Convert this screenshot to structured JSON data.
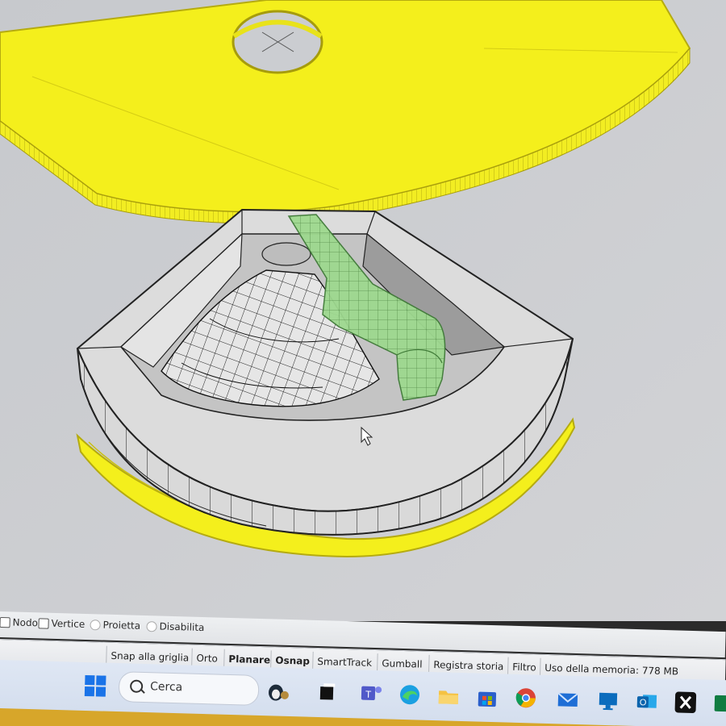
{
  "osnap": {
    "items": [
      {
        "label": "Nodo",
        "checked": false
      },
      {
        "label": "Vertice",
        "checked": false
      },
      {
        "label": "Proietta",
        "checked": false
      },
      {
        "label": "Disabilita",
        "checked": false
      }
    ]
  },
  "statusbar": {
    "panes": [
      "Snap alla griglia",
      "Orto",
      "Planare",
      "Osnap",
      "SmartTrack",
      "Gumball",
      "Registra storia",
      "Filtro"
    ],
    "memory": "Uso della memoria: 778 MB"
  },
  "taskbar": {
    "search_placeholder": "Cerca",
    "icons": [
      "windows-start-icon",
      "penguin-widget-icon",
      "task-view-icon",
      "teams-icon",
      "edge-icon",
      "file-explorer-icon",
      "store-icon",
      "chrome-icon",
      "mail-icon",
      "remote-desktop-icon",
      "outlook-icon",
      "x-app-icon",
      "excel-icon"
    ]
  },
  "colors": {
    "model_yellow": "#f4ef1c",
    "model_green": "#9ed98f",
    "viewport_bg": "#c9cbcf",
    "wall_grey": "#d8d8d8"
  }
}
